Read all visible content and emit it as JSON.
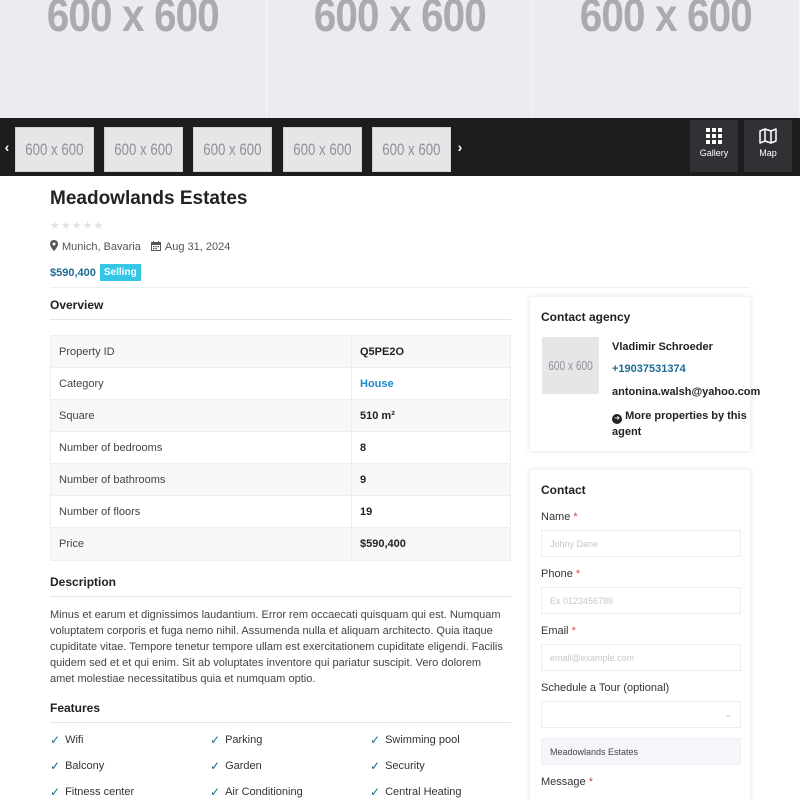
{
  "hero": {
    "images": [
      "600 x 600",
      "600 x 600",
      "600 x 600"
    ]
  },
  "strip": {
    "prev_icon": "chevron-left-icon",
    "next_icon": "chevron-right-icon",
    "thumbs": [
      "600 x 600",
      "600 x 600",
      "600 x 600",
      "600 x 600",
      "600 x 600"
    ],
    "gallery_label": "Gallery",
    "map_label": "Map"
  },
  "property": {
    "title": "Meadowlands Estates",
    "stars": "★★★★★",
    "location": "Munich, Bavaria",
    "date": "Aug 31, 2024",
    "price": "$590,400",
    "status": "Selling"
  },
  "overview": {
    "heading": "Overview",
    "rows": [
      {
        "key": "Property ID",
        "value": "Q5PE2O"
      },
      {
        "key": "Category",
        "value": "House"
      },
      {
        "key": "Square",
        "value": "510 m²"
      },
      {
        "key": "Number of bedrooms",
        "value": "8"
      },
      {
        "key": "Number of bathrooms",
        "value": "9"
      },
      {
        "key": "Number of floors",
        "value": "19"
      },
      {
        "key": "Price",
        "value": "$590,400"
      }
    ]
  },
  "description": {
    "heading": "Description",
    "text": "Minus et earum et dignissimos laudantium. Error rem occaecati quisquam qui est. Numquam voluptatem corporis et fuga nemo nihil. Assumenda nulla et aliquam architecto. Quia itaque cupiditate vitae. Tempore tenetur tempore ullam est exercitationem cupiditate eligendi. Facilis quidem sed et et qui enim. Sit ab voluptates inventore qui pariatur suscipit. Vero dolorem amet molestiae necessitatibus quia et numquam optio."
  },
  "features": {
    "heading": "Features",
    "items": [
      "Wifi",
      "Parking",
      "Swimming pool",
      "Balcony",
      "Garden",
      "Security",
      "Fitness center",
      "Air Conditioning",
      "Central Heating"
    ]
  },
  "agency": {
    "heading": "Contact agency",
    "image": "600 x 600",
    "name": "Vladimir Schroeder",
    "phone": "+19037531374",
    "email": "antonina.walsh@yahoo.com",
    "more_line1": "More properties by this",
    "more_line2": "agent"
  },
  "contact": {
    "heading": "Contact",
    "name_label": "Name",
    "name_placeholder": "Johny Dane",
    "phone_label": "Phone",
    "phone_placeholder": "Ex 0123456789",
    "email_label": "Email",
    "email_placeholder": "email@example.com",
    "tour_label": "Schedule a Tour (optional)",
    "subject_value": "Meadowlands Estates",
    "message_label": "Message",
    "required_mark": "*"
  },
  "colors": {
    "accent": "#1b6c95",
    "badge": "#35c6e6",
    "strip": "#1d1d1d",
    "required": "#e0453b"
  }
}
